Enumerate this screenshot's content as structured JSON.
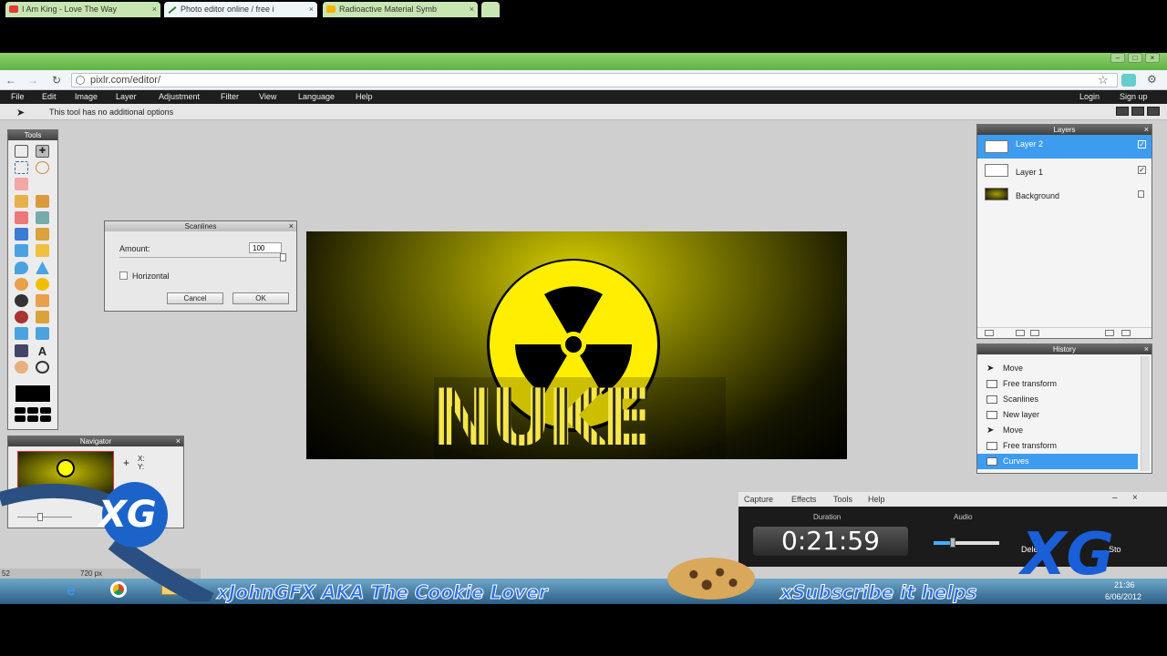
{
  "browser": {
    "tabs": [
      {
        "label": "I Am King - Love The Way",
        "icon_color": "#e53935"
      },
      {
        "label": "Photo editor online / free i",
        "icon_color": "#2e7d32"
      },
      {
        "label": "Radioactive Material Symb",
        "icon_color": "#f4b400"
      }
    ],
    "url": "pixlr.com/editor/"
  },
  "menu": {
    "items": [
      "File",
      "Edit",
      "Image",
      "Layer",
      "Adjustment",
      "Filter",
      "View",
      "Language",
      "Help"
    ],
    "login": "Login",
    "signup": "Sign up"
  },
  "options": {
    "hint": "This tool has no additional options"
  },
  "tools_panel": {
    "title": "Tools",
    "foreground_color": "#000000"
  },
  "navigator": {
    "title": "Navigator",
    "x_label": "X:",
    "y_label": "Y:"
  },
  "scanlines_dialog": {
    "title": "Scanlines",
    "amount_label": "Amount:",
    "amount_value": "100",
    "horizontal_label": "Horizontal",
    "cancel_label": "Cancel",
    "ok_label": "OK"
  },
  "canvas": {
    "logo_text": "NUKE",
    "bg_color": "#d8d000"
  },
  "layers": {
    "title": "Layers",
    "items": [
      {
        "name": "Layer 2",
        "selected": true
      },
      {
        "name": "Layer 1",
        "selected": false
      },
      {
        "name": "Background",
        "selected": false
      }
    ]
  },
  "history": {
    "title": "History",
    "items": [
      "Move",
      "Free transform",
      "Scanlines",
      "New layer",
      "Move",
      "Free transform",
      "Curves"
    ],
    "selected_index": 6
  },
  "status": {
    "zoom": "52",
    "size": "720 px"
  },
  "capture_widget": {
    "menu": [
      "Capture",
      "Effects",
      "Tools",
      "Help"
    ],
    "duration_label": "Duration",
    "duration_value": "0:21:59",
    "audio_label": "Audio",
    "delete_label": "Delete",
    "stop_label": "Sto"
  },
  "overlay": {
    "left_text": "xJohnGFX AKA The Cookie Lover",
    "right_text": "xSubscribe it helps",
    "logo": "XG"
  },
  "taskbar": {
    "time": "21:36",
    "date": "6/06/2012"
  }
}
